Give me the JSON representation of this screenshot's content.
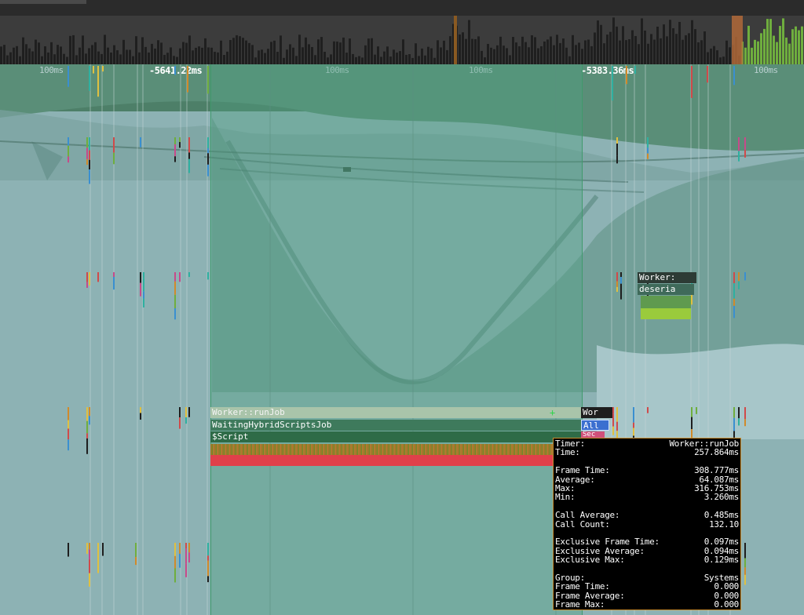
{
  "ruler": {
    "tick_labels": [
      "100ms",
      "-5641.22ms",
      "100ms",
      "100ms",
      "-5383.36ms",
      "100ms"
    ]
  },
  "bars": {
    "run_job": "Worker::runJob",
    "waiting": "WaitingHybridScriptsJob",
    "script": "$Script",
    "side_worker": "Wor",
    "side_all": "All",
    "side_sec": "Sec"
  },
  "mini_box": {
    "title": "Worker:",
    "subtitle": "deseria"
  },
  "tooltip": {
    "timer_label": "Timer:",
    "timer_value": "Worker::runJob",
    "time_label": "Time:",
    "time_value": "257.864ms",
    "frame_time_label": "Frame Time:",
    "frame_time_value": "308.777ms",
    "average_label": "Average:",
    "average_value": "64.087ms",
    "max_label": "Max:",
    "max_value": "316.753ms",
    "min_label": "Min:",
    "min_value": "3.260ms",
    "call_average_label": "Call Average:",
    "call_average_value": "0.485ms",
    "call_count_label": "Call Count:",
    "call_count_value": "132.10",
    "excl_frame_time_label": "Exclusive Frame Time:",
    "excl_frame_time_value": "0.097ms",
    "excl_average_label": "Exclusive Average:",
    "excl_average_value": "0.094ms",
    "excl_max_label": "Exclusive Max:",
    "excl_max_value": "0.129ms",
    "group_label": "Group:",
    "group_value": "Systems",
    "group_frame_time_label": "Frame Time:",
    "group_frame_time_value": "0.000",
    "group_frame_average_label": "Frame Average:",
    "group_frame_average_value": "0.000",
    "group_frame_max_label": "Frame Max:",
    "group_frame_max_value": "0.000"
  },
  "colors": {
    "histogram_bg": "#3c3c3c",
    "histogram_bar": "#1f1f1f",
    "histogram_highlight": "#6fae3e",
    "selection": "#4fa082",
    "run_job_bar": "#a9c4aa",
    "waiting_bar": "#3e7a5c",
    "script_bar": "#2e6b47",
    "stripe_bar": "#9a7a2a",
    "red_bar": "#e0404a",
    "tooltip_border": "#c98d2f"
  }
}
